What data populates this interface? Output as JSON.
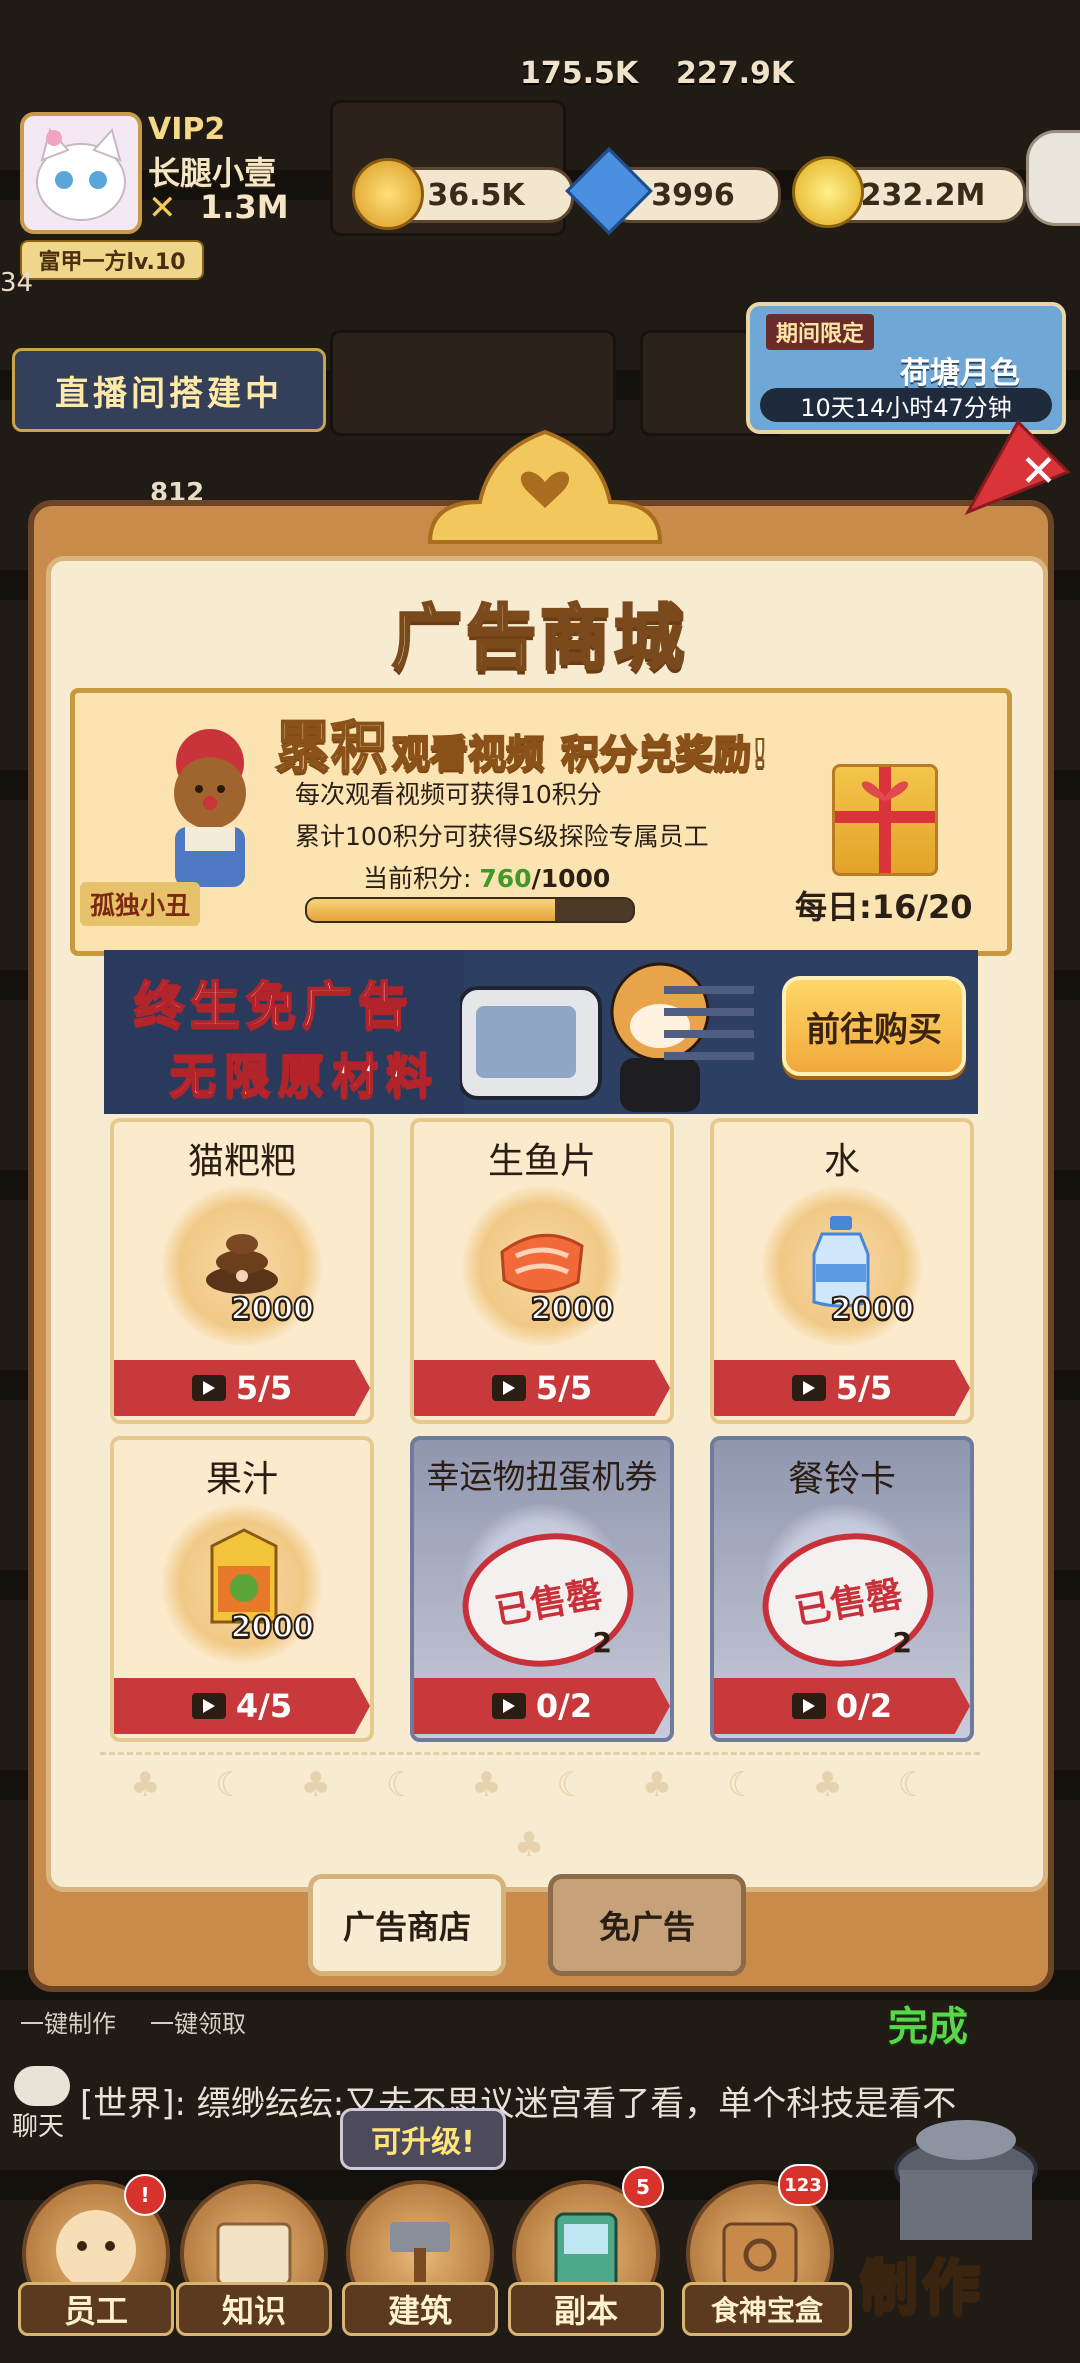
{
  "hud": {
    "top_counters": [
      "175.5K",
      "227.9K"
    ],
    "vip": "VIP2",
    "player_name": "长腿小壹",
    "player_power": "1.3M",
    "currencies": [
      {
        "icon": "trophy-icon",
        "value": "36.5K"
      },
      {
        "icon": "diamond-icon",
        "value": "3996"
      },
      {
        "icon": "gold-coin-icon",
        "value": "232.2M"
      }
    ],
    "rank_title": "富甲一方lv.10",
    "left_count": "34",
    "live_button": "直播间搭建中",
    "event": {
      "tag": "期间限定",
      "name": "荷塘月色",
      "timer": "10天14小时47分钟"
    },
    "side_counter": "812"
  },
  "panel": {
    "title": "广告商城",
    "promo": {
      "headline_big": "累积",
      "headline_mid": "观看视频",
      "headline_end": "积分兑奖励!",
      "line1": "每次观看视频可获得10积分",
      "line2": "累计100积分可获得S级探险专属员工",
      "points_label": "当前积分:",
      "points_current": "760",
      "points_total": "/1000",
      "points_fraction": 0.76,
      "mascot_name": "孤独小丑",
      "daily": "每日:16/20"
    },
    "noads_banner": {
      "line1": "终生免广告",
      "line2": "无限原材料",
      "button": "前往购买"
    },
    "items": [
      {
        "name": "猫粑粑",
        "qty": "2000",
        "count": "5/5",
        "sold": false,
        "icon": "poop-icon"
      },
      {
        "name": "生鱼片",
        "qty": "2000",
        "count": "5/5",
        "sold": false,
        "icon": "fish-slice-icon"
      },
      {
        "name": "水",
        "qty": "2000",
        "count": "5/5",
        "sold": false,
        "icon": "water-bottle-icon"
      },
      {
        "name": "果汁",
        "qty": "2000",
        "count": "4/5",
        "sold": false,
        "icon": "juice-box-icon"
      },
      {
        "name": "幸运物扭蛋机券",
        "qty": "2",
        "count": "0/2",
        "sold": true,
        "icon": "sold-out-stamp-icon"
      },
      {
        "name": "餐铃卡",
        "qty": "2",
        "count": "0/2",
        "sold": true,
        "icon": "sold-out-stamp-icon"
      }
    ],
    "sold_out": "已售罄",
    "tabs": [
      "广告商店",
      "免广告"
    ]
  },
  "bottom": {
    "quick_left": "一键制作",
    "quick_right": "一键领取",
    "done": "完成",
    "chat_label": "聊天",
    "chat_text": "[世界]:  缥缈纭纭:又去不思议迷宫看了看，单个科技是看不",
    "upgrade_tip": "可升级!",
    "dock": [
      {
        "label": "员工",
        "badge": ""
      },
      {
        "label": "知识",
        "badge": ""
      },
      {
        "label": "建筑",
        "badge": ""
      },
      {
        "label": "副本",
        "badge": "5"
      },
      {
        "label": "食神宝盒",
        "badge": "123"
      }
    ],
    "make": "制作"
  }
}
